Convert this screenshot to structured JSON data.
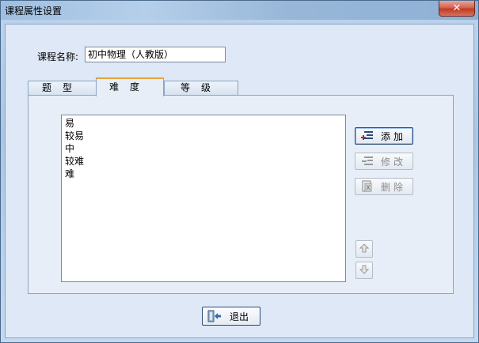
{
  "window": {
    "title": "课程属性设置",
    "close_label": "✕"
  },
  "course": {
    "name_label": "课程名称:",
    "name_value": "初中物理（人教版）"
  },
  "tabs": [
    {
      "label": "题型",
      "active": false
    },
    {
      "label": "难度",
      "active": true
    },
    {
      "label": "等级",
      "active": false
    }
  ],
  "difficulty_list": [
    "易",
    "较易",
    "中",
    "较难",
    "难"
  ],
  "buttons": {
    "add": {
      "label": "添加",
      "icon": "add-icon",
      "enabled": true
    },
    "edit": {
      "label": "修改",
      "icon": "edit-icon",
      "enabled": false
    },
    "delete": {
      "label": "删除",
      "icon": "delete-icon",
      "enabled": false
    },
    "move_up": {
      "icon": "arrow-up-icon",
      "enabled": false
    },
    "move_down": {
      "icon": "arrow-down-icon",
      "enabled": false
    },
    "exit": {
      "label": "退出",
      "icon": "exit-icon"
    }
  },
  "colors": {
    "active_tab_accent": "#e8a33a",
    "close_button": "#c23a23"
  }
}
